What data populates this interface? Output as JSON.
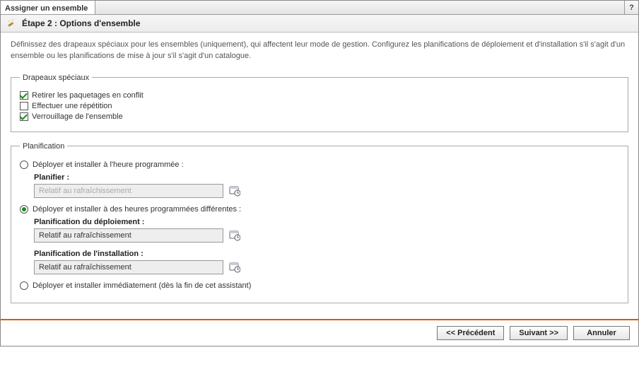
{
  "window": {
    "title": "Assigner un ensemble"
  },
  "step": {
    "title": "Étape 2 : Options d'ensemble"
  },
  "intro": "Définissez des drapeaux spéciaux pour les ensembles (uniquement), qui affectent leur mode de gestion. Configurez les planifications de déploiement et d'installation s'il s'agit d'un ensemble ou les planifications de mise à jour s'il s'agit d'un catalogue.",
  "flags": {
    "legend": "Drapeaux spéciaux",
    "items": [
      {
        "label": "Retirer les paquetages en conflit",
        "checked": true
      },
      {
        "label": "Effectuer une répétition",
        "checked": false
      },
      {
        "label": "Verrouillage de l'ensemble",
        "checked": true
      }
    ]
  },
  "schedule": {
    "legend": "Planification",
    "options": [
      {
        "label": "Déployer et installer à l'heure programmée :",
        "selected": false,
        "fields": [
          {
            "label": "Planifier :",
            "value": "Relatif au rafraîchissement",
            "disabled": true
          }
        ]
      },
      {
        "label": "Déployer et installer à des heures programmées différentes :",
        "selected": true,
        "fields": [
          {
            "label": "Planification du déploiement :",
            "value": "Relatif au rafraîchissement",
            "disabled": false
          },
          {
            "label": "Planification de l'installation :",
            "value": "Relatif au rafraîchissement",
            "disabled": false
          }
        ]
      },
      {
        "label": "Déployer et installer immédiatement (dès la fin de cet assistant)",
        "selected": false,
        "fields": []
      }
    ]
  },
  "footer": {
    "prev": "<< Précédent",
    "next": "Suivant >>",
    "cancel": "Annuler"
  }
}
